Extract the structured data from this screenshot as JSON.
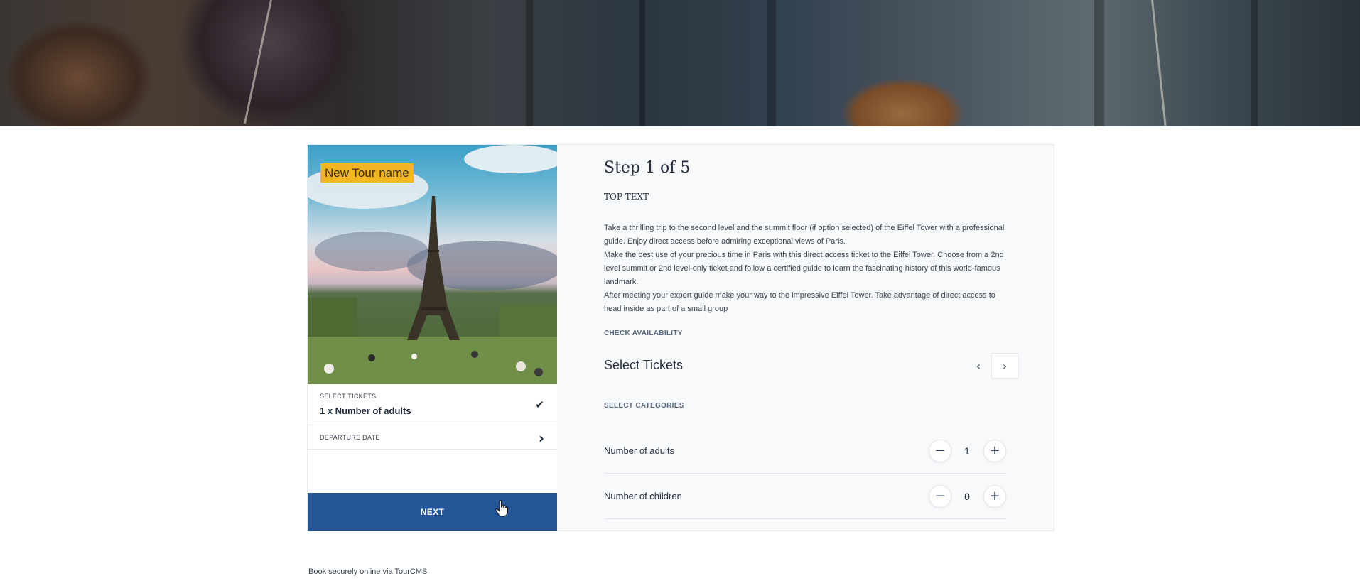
{
  "tour": {
    "badge": "New Tour name"
  },
  "summary": {
    "tickets_label": "SELECT TICKETS",
    "tickets_value": "1 x Number of adults",
    "departure_label": "DEPARTURE DATE"
  },
  "next_label": "NEXT",
  "step": {
    "title": "Step 1 of 5",
    "top_text": "TOP TEXT",
    "description": [
      "Take a thrilling trip to the second level and the summit floor (if option selected) of the Eiffel Tower with a professional guide. Enjoy direct access before admiring exceptional views of Paris.",
      "Make the best use of your precious time in Paris with this direct access ticket to the Eiffel Tower. Choose from a 2nd level summit or 2nd level-only ticket and follow a certified guide to learn the fascinating history of this world-famous landmark.",
      "After meeting your expert guide make your way to the impressive Eiffel Tower. Take advantage of direct access to head inside as part of a small group"
    ],
    "check_availability": "CHECK AVAILABILITY",
    "select_tickets": "Select Tickets",
    "select_categories": "SELECT CATEGORIES"
  },
  "categories": [
    {
      "name": "Number of adults",
      "qty": "1"
    },
    {
      "name": "Number of children",
      "qty": "0"
    }
  ],
  "icons": {
    "minus": "−",
    "plus": "+",
    "prev": "‹",
    "next": "›",
    "check": "✔",
    "chevron": "›"
  },
  "footer": "Book securely online via TourCMS",
  "colors": {
    "primary": "#235597",
    "badge": "#f3b623"
  }
}
